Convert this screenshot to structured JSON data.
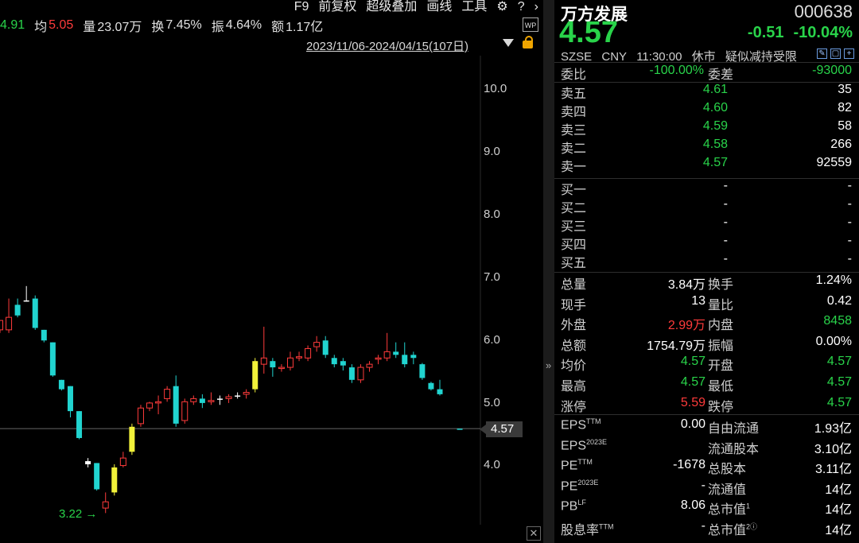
{
  "toolbar": {
    "items": [
      "F9",
      "前复权",
      "超级叠加",
      "画线",
      "工具"
    ],
    "settings_icon": "gear-icon",
    "help_icon": "help-icon",
    "next_icon": "chevron-right-icon"
  },
  "stats": {
    "last_partial": "4.91",
    "avg_label": "均",
    "avg_value": "5.05",
    "volume_label": "量",
    "volume_value": "23.07万",
    "turnover_label": "换",
    "turnover_value": "7.45%",
    "amplitude_label": "振",
    "amplitude_value": "4.64%",
    "amount_label": "额",
    "amount_value": "1.17亿"
  },
  "range": "2023/11/06-2024/04/15(107日)",
  "wp_label": "WP",
  "yaxis": [
    "10.0",
    "9.0",
    "8.0",
    "7.0",
    "6.0",
    "5.0",
    "4.0"
  ],
  "current_price_tag": "4.57",
  "low_label": "3.22 →",
  "chart_data": {
    "type": "candlestick",
    "y_ticks": [
      4.0,
      5.0,
      6.0,
      7.0,
      8.0,
      9.0,
      10.0
    ],
    "current_price": 4.57,
    "marked_low": 3.22,
    "candles": [
      {
        "o": 6.3,
        "h": 6.3,
        "l": 6.1,
        "c": 6.15,
        "color": "red"
      },
      {
        "o": 6.35,
        "h": 6.65,
        "l": 6.1,
        "c": 6.15,
        "color": "red"
      },
      {
        "o": 6.55,
        "h": 6.65,
        "l": 6.35,
        "c": 6.38,
        "color": "cyan"
      },
      {
        "o": 6.62,
        "h": 6.85,
        "l": 6.6,
        "c": 6.62,
        "color": "white"
      },
      {
        "o": 6.65,
        "h": 6.7,
        "l": 6.15,
        "c": 6.18,
        "color": "cyan"
      },
      {
        "o": 6.15,
        "h": 6.15,
        "l": 5.95,
        "c": 5.98,
        "color": "cyan"
      },
      {
        "o": 5.95,
        "h": 5.95,
        "l": 5.4,
        "c": 5.42,
        "color": "cyan"
      },
      {
        "o": 5.35,
        "h": 5.35,
        "l": 5.18,
        "c": 5.2,
        "color": "cyan"
      },
      {
        "o": 5.25,
        "h": 5.25,
        "l": 4.75,
        "c": 4.85,
        "color": "cyan"
      },
      {
        "o": 4.85,
        "h": 4.85,
        "l": 4.4,
        "c": 4.42,
        "color": "cyan"
      },
      {
        "o": 4.05,
        "h": 4.1,
        "l": 3.95,
        "c": 4.0,
        "color": "white"
      },
      {
        "o": 4.02,
        "h": 4.02,
        "l": 3.58,
        "c": 3.6,
        "color": "cyan"
      },
      {
        "o": 3.4,
        "h": 3.55,
        "l": 3.22,
        "c": 3.3,
        "color": "red"
      },
      {
        "o": 3.55,
        "h": 4.0,
        "l": 3.5,
        "c": 3.95,
        "color": "yellow"
      },
      {
        "o": 3.98,
        "h": 4.2,
        "l": 3.95,
        "c": 4.1,
        "color": "red"
      },
      {
        "o": 4.2,
        "h": 4.65,
        "l": 4.15,
        "c": 4.6,
        "color": "yellow"
      },
      {
        "o": 4.65,
        "h": 4.95,
        "l": 4.6,
        "c": 4.9,
        "color": "red"
      },
      {
        "o": 4.9,
        "h": 5.0,
        "l": 4.85,
        "c": 4.98,
        "color": "red"
      },
      {
        "o": 4.98,
        "h": 5.1,
        "l": 4.8,
        "c": 5.0,
        "color": "red"
      },
      {
        "o": 5.05,
        "h": 5.25,
        "l": 5.0,
        "c": 5.2,
        "color": "red"
      },
      {
        "o": 5.25,
        "h": 5.42,
        "l": 4.6,
        "c": 4.65,
        "color": "cyan"
      },
      {
        "o": 4.7,
        "h": 5.05,
        "l": 4.65,
        "c": 5.0,
        "color": "red"
      },
      {
        "o": 5.05,
        "h": 5.1,
        "l": 4.95,
        "c": 5.0,
        "color": "red"
      },
      {
        "o": 5.05,
        "h": 5.12,
        "l": 4.9,
        "c": 4.98,
        "color": "cyan"
      },
      {
        "o": 5.0,
        "h": 5.15,
        "l": 4.95,
        "c": 5.02,
        "color": "red"
      },
      {
        "o": 5.05,
        "h": 5.1,
        "l": 4.95,
        "c": 5.05,
        "color": "white"
      },
      {
        "o": 5.05,
        "h": 5.12,
        "l": 4.98,
        "c": 5.08,
        "color": "red"
      },
      {
        "o": 5.1,
        "h": 5.15,
        "l": 5.05,
        "c": 5.1,
        "color": "white"
      },
      {
        "o": 5.12,
        "h": 5.2,
        "l": 5.05,
        "c": 5.15,
        "color": "red"
      },
      {
        "o": 5.2,
        "h": 5.7,
        "l": 5.15,
        "c": 5.65,
        "color": "yellow"
      },
      {
        "o": 5.7,
        "h": 6.2,
        "l": 5.45,
        "c": 5.6,
        "color": "red"
      },
      {
        "o": 5.65,
        "h": 5.7,
        "l": 5.4,
        "c": 5.55,
        "color": "cyan"
      },
      {
        "o": 5.55,
        "h": 5.6,
        "l": 5.48,
        "c": 5.55,
        "color": "red"
      },
      {
        "o": 5.55,
        "h": 5.8,
        "l": 5.5,
        "c": 5.7,
        "color": "red"
      },
      {
        "o": 5.7,
        "h": 5.8,
        "l": 5.65,
        "c": 5.72,
        "color": "red"
      },
      {
        "o": 5.7,
        "h": 5.9,
        "l": 5.65,
        "c": 5.85,
        "color": "red"
      },
      {
        "o": 5.88,
        "h": 6.05,
        "l": 5.8,
        "c": 5.95,
        "color": "red"
      },
      {
        "o": 5.98,
        "h": 6.05,
        "l": 5.7,
        "c": 5.75,
        "color": "cyan"
      },
      {
        "o": 5.7,
        "h": 5.75,
        "l": 5.55,
        "c": 5.6,
        "color": "cyan"
      },
      {
        "o": 5.65,
        "h": 5.7,
        "l": 5.5,
        "c": 5.58,
        "color": "cyan"
      },
      {
        "o": 5.55,
        "h": 5.6,
        "l": 5.3,
        "c": 5.35,
        "color": "cyan"
      },
      {
        "o": 5.35,
        "h": 5.6,
        "l": 5.3,
        "c": 5.55,
        "color": "red"
      },
      {
        "o": 5.55,
        "h": 5.65,
        "l": 5.48,
        "c": 5.6,
        "color": "red"
      },
      {
        "o": 5.68,
        "h": 5.75,
        "l": 5.6,
        "c": 5.7,
        "color": "red"
      },
      {
        "o": 5.7,
        "h": 6.1,
        "l": 5.65,
        "c": 5.8,
        "color": "red"
      },
      {
        "o": 5.8,
        "h": 5.95,
        "l": 5.7,
        "c": 5.75,
        "color": "cyan"
      },
      {
        "o": 5.75,
        "h": 5.95,
        "l": 5.55,
        "c": 5.6,
        "color": "cyan"
      },
      {
        "o": 5.75,
        "h": 5.8,
        "l": 5.6,
        "c": 5.7,
        "color": "cyan"
      },
      {
        "o": 5.6,
        "h": 5.62,
        "l": 5.35,
        "c": 5.38,
        "color": "cyan"
      },
      {
        "o": 5.3,
        "h": 5.32,
        "l": 5.18,
        "c": 5.2,
        "color": "cyan"
      },
      {
        "o": 5.2,
        "h": 5.35,
        "l": 5.1,
        "c": 5.12,
        "color": "cyan"
      },
      {
        "o": 4.57,
        "h": 4.57,
        "l": 4.57,
        "c": 4.57,
        "color": "cyan"
      }
    ]
  },
  "quote": {
    "name": "万方发展",
    "code": "000638",
    "price": "4.57",
    "change": "-0.51",
    "change_pct": "-10.04%",
    "exchange": "SZSE",
    "currency": "CNY",
    "time": "11:30:00",
    "status": "休市",
    "note": "疑似减持受限"
  },
  "order_book": {
    "committee_label": "委比",
    "committee_value": "-100.00%",
    "diff_label": "委差",
    "diff_value": "-93000",
    "asks": [
      {
        "label": "卖五",
        "price": "4.61",
        "vol": "35"
      },
      {
        "label": "卖四",
        "price": "4.60",
        "vol": "82"
      },
      {
        "label": "卖三",
        "price": "4.59",
        "vol": "58"
      },
      {
        "label": "卖二",
        "price": "4.58",
        "vol": "266"
      },
      {
        "label": "卖一",
        "price": "4.57",
        "vol": "92559"
      }
    ],
    "bids": [
      {
        "label": "买一",
        "price": "-",
        "vol": "-"
      },
      {
        "label": "买二",
        "price": "-",
        "vol": "-"
      },
      {
        "label": "买三",
        "price": "-",
        "vol": "-"
      },
      {
        "label": "买四",
        "price": "-",
        "vol": "-"
      },
      {
        "label": "买五",
        "price": "-",
        "vol": "-"
      }
    ]
  },
  "details": [
    {
      "l1": "总量",
      "v1": "3.84万",
      "c1": "white",
      "l2": "换手",
      "v2": "1.24%",
      "c2": "white"
    },
    {
      "l1": "现手",
      "v1": "13",
      "c1": "white",
      "l2": "量比",
      "v2": "0.42",
      "c2": "white"
    },
    {
      "l1": "外盘",
      "v1": "2.99万",
      "c1": "red",
      "l2": "内盘",
      "v2": "8458",
      "c2": "green"
    },
    {
      "l1": "总额",
      "v1": "1754.79万",
      "c1": "white",
      "l2": "振幅",
      "v2": "0.00%",
      "c2": "white"
    },
    {
      "l1": "均价",
      "v1": "4.57",
      "c1": "green",
      "l2": "开盘",
      "v2": "4.57",
      "c2": "green"
    },
    {
      "l1": "最高",
      "v1": "4.57",
      "c1": "green",
      "l2": "最低",
      "v2": "4.57",
      "c2": "green"
    },
    {
      "l1": "涨停",
      "v1": "5.59",
      "c1": "red",
      "l2": "跌停",
      "v2": "4.57",
      "c2": "green"
    }
  ],
  "fundamentals": [
    {
      "l1": "EPS",
      "s1": "TTM",
      "v1": "0.00",
      "l2": "自由流通",
      "s2": "",
      "v2": "1.93亿"
    },
    {
      "l1": "EPS",
      "s1": "2023E",
      "v1": "",
      "l2": "流通股本",
      "s2": "",
      "v2": "3.10亿"
    },
    {
      "l1": "PE",
      "s1": "TTM",
      "v1": "-1678",
      "l2": "总股本",
      "s2": "",
      "v2": "3.11亿"
    },
    {
      "l1": "PE",
      "s1": "2023E",
      "v1": "-",
      "l2": "流通值",
      "s2": "",
      "v2": "14亿"
    },
    {
      "l1": "PB",
      "s1": "LF",
      "v1": "8.06",
      "l2": "总市值",
      "s2": "1",
      "v2": "14亿"
    },
    {
      "l1": "股息率",
      "s1": "TTM",
      "v1": "-",
      "l2": "总市值",
      "s2": "2ⓘ",
      "v2": "14亿"
    }
  ],
  "colors": {
    "up": "#ff3b3b",
    "down": "#29d34a",
    "cyan_candle": "#21d4d0",
    "yellow_candle": "#f2f23a",
    "background": "#000000"
  }
}
